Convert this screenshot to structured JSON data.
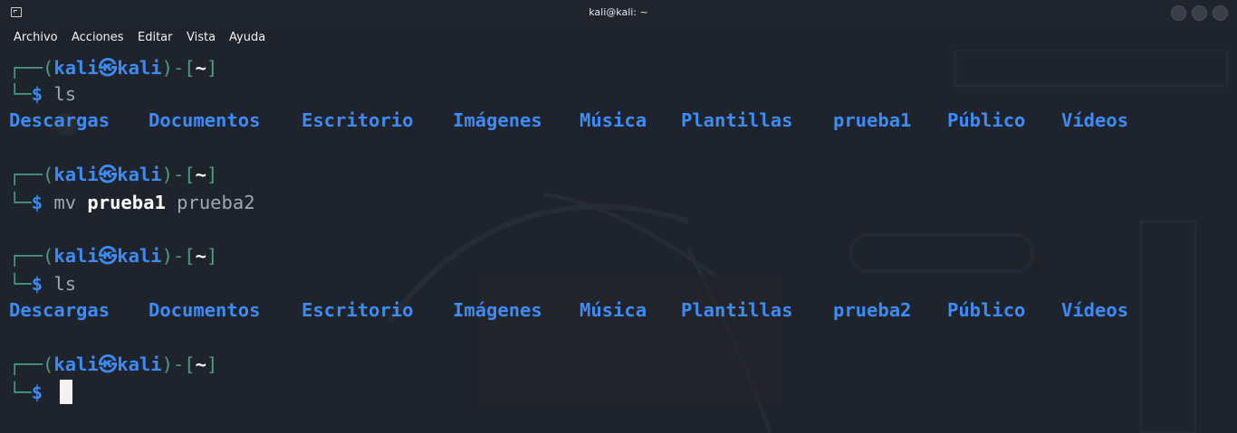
{
  "window": {
    "title": "kali@kali: ~"
  },
  "menu": {
    "items": [
      "Archivo",
      "Acciones",
      "Editar",
      "Vista",
      "Ayuda"
    ]
  },
  "prompt": {
    "open": "┌──(",
    "user": "kali",
    "at_symbol": "㉿",
    "host": "kali",
    "close": ")-[",
    "dir": "~",
    "end": "]",
    "corner": "└─",
    "dollar": "$"
  },
  "commands": {
    "c1": "ls",
    "c2_cmd": "mv",
    "c2_arg1": "prueba1",
    "c2_arg2": "prueba2",
    "c3": "ls"
  },
  "listing1": [
    "Descargas",
    "Documentos",
    "Escritorio",
    "Imágenes",
    "Música",
    "Plantillas",
    "prueba1",
    "Público",
    "Vídeos"
  ],
  "listing2": [
    "Descargas",
    "Documentos",
    "Escritorio",
    "Imágenes",
    "Música",
    "Plantillas",
    "prueba2",
    "Público",
    "Vídeos"
  ],
  "colors": {
    "background": "#1f232b",
    "prompt_frame": "#4c9d84",
    "prompt_user": "#3d8bf5",
    "directory": "#3d8bf5"
  }
}
